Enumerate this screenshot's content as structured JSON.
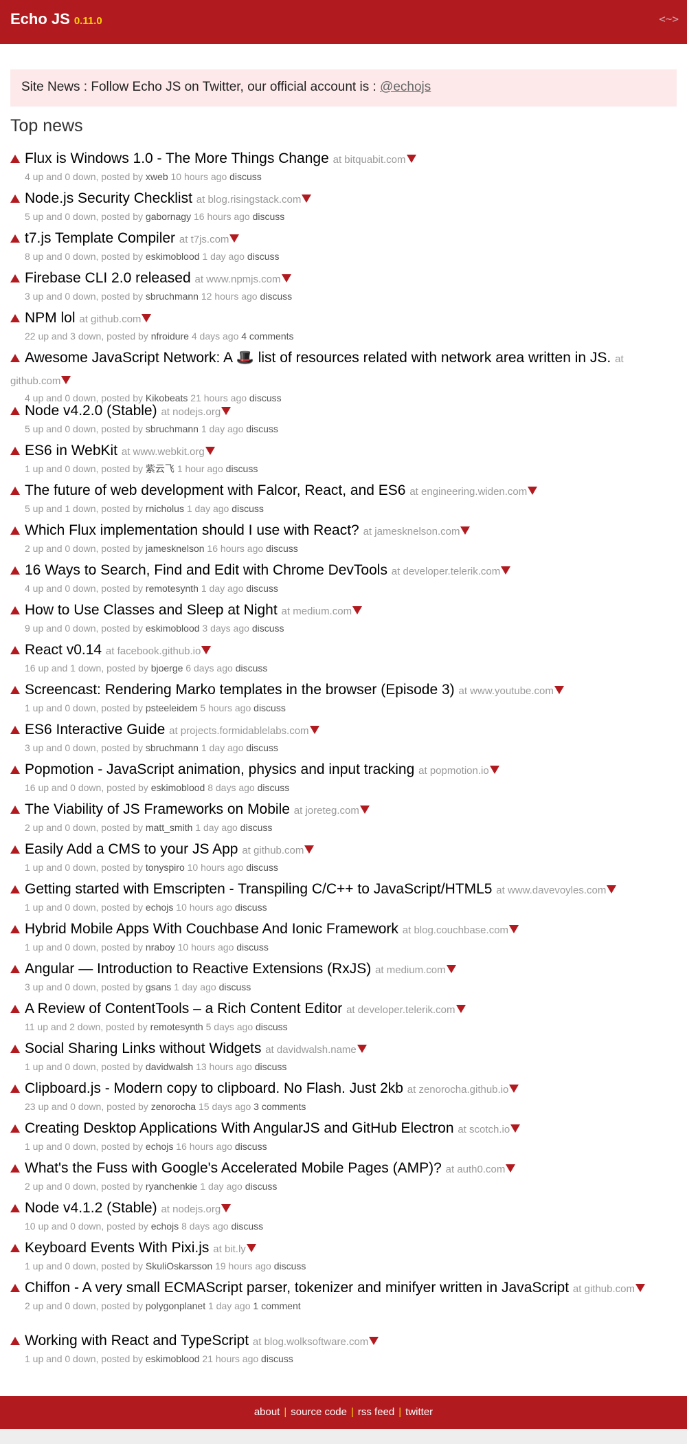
{
  "header": {
    "logo": "Echo JS",
    "version": "0.11.0",
    "nav_toggle": "<~>"
  },
  "site_news": {
    "text": "Site News : Follow Echo JS on Twitter, our official account is : ",
    "link": "@echojs"
  },
  "section_title": "Top news",
  "news": [
    {
      "title": "Flux is Windows 1.0 - The More Things Change",
      "domain": "at bitquabit.com",
      "votes": "4 up and 0 down, posted by",
      "user": "xweb",
      "ago": "10 hours ago",
      "discuss": "discuss"
    },
    {
      "title": "Node.js Security Checklist",
      "domain": "at blog.risingstack.com",
      "votes": "5 up and 0 down, posted by",
      "user": "gabornagy",
      "ago": "16 hours ago",
      "discuss": "discuss"
    },
    {
      "title": "t7.js Template Compiler",
      "domain": "at t7js.com",
      "votes": "8 up and 0 down, posted by",
      "user": "eskimoblood",
      "ago": "1 day ago",
      "discuss": "discuss"
    },
    {
      "title": "Firebase CLI 2.0 released",
      "domain": "at www.npmjs.com",
      "votes": "3 up and 0 down, posted by",
      "user": "sbruchmann",
      "ago": "12 hours ago",
      "discuss": "discuss"
    },
    {
      "title": "NPM lol",
      "domain": "at github.com",
      "votes": "22 up and 3 down, posted by",
      "user": "nfroidure",
      "ago": "4 days ago",
      "discuss": "4 comments"
    },
    {
      "title": "Awesome JavaScript Network: A 🎩 list of resources related with network area written in JS.",
      "domain": "at github.com",
      "votes": "4 up and 0 down, posted by",
      "user": "Kikobeats",
      "ago": "21 hours ago",
      "discuss": "discuss"
    },
    {
      "title": "Node v4.2.0 (Stable)",
      "domain": "at nodejs.org",
      "votes": "5 up and 0 down, posted by",
      "user": "sbruchmann",
      "ago": "1 day ago",
      "discuss": "discuss"
    },
    {
      "title": "ES6 in WebKit",
      "domain": "at www.webkit.org",
      "votes": "1 up and 0 down, posted by",
      "user": "紫云飞",
      "ago": "1 hour ago",
      "discuss": "discuss"
    },
    {
      "title": "The future of web development with Falcor, React, and ES6",
      "domain": "at engineering.widen.com",
      "votes": "5 up and 1 down, posted by",
      "user": "rnicholus",
      "ago": "1 day ago",
      "discuss": "discuss"
    },
    {
      "title": "Which Flux implementation should I use with React?",
      "domain": "at jamesknelson.com",
      "votes": "2 up and 0 down, posted by",
      "user": "jamesknelson",
      "ago": "16 hours ago",
      "discuss": "discuss"
    },
    {
      "title": "16 Ways to Search, Find and Edit with Chrome DevTools",
      "domain": "at developer.telerik.com",
      "votes": "4 up and 0 down, posted by",
      "user": "remotesynth",
      "ago": "1 day ago",
      "discuss": "discuss"
    },
    {
      "title": "How to Use Classes and Sleep at Night",
      "domain": "at medium.com",
      "votes": "9 up and 0 down, posted by",
      "user": "eskimoblood",
      "ago": "3 days ago",
      "discuss": "discuss"
    },
    {
      "title": "React v0.14",
      "domain": "at facebook.github.io",
      "votes": "16 up and 1 down, posted by",
      "user": "bjoerge",
      "ago": "6 days ago",
      "discuss": "discuss"
    },
    {
      "title": "Screencast: Rendering Marko templates in the browser (Episode 3)",
      "domain": "at www.youtube.com",
      "votes": "1 up and 0 down, posted by",
      "user": "psteeleidem",
      "ago": "5 hours ago",
      "discuss": "discuss"
    },
    {
      "title": "ES6 Interactive Guide",
      "domain": "at projects.formidablelabs.com",
      "votes": "3 up and 0 down, posted by",
      "user": "sbruchmann",
      "ago": "1 day ago",
      "discuss": "discuss"
    },
    {
      "title": "Popmotion - JavaScript animation, physics and input tracking",
      "domain": "at popmotion.io",
      "votes": "16 up and 0 down, posted by",
      "user": "eskimoblood",
      "ago": "8 days ago",
      "discuss": "discuss"
    },
    {
      "title": "The Viability of JS Frameworks on Mobile",
      "domain": "at joreteg.com",
      "votes": "2 up and 0 down, posted by",
      "user": "matt_smith",
      "ago": "1 day ago",
      "discuss": "discuss"
    },
    {
      "title": "Easily Add a CMS to your JS App",
      "domain": "at github.com",
      "votes": "1 up and 0 down, posted by",
      "user": "tonyspiro",
      "ago": "10 hours ago",
      "discuss": "discuss"
    },
    {
      "title": "Getting started with Emscripten - Transpiling C/C++ to JavaScript/HTML5",
      "domain": "at www.davevoyles.com",
      "votes": "1 up and 0 down, posted by",
      "user": "echojs",
      "ago": "10 hours ago",
      "discuss": "discuss"
    },
    {
      "title": "Hybrid Mobile Apps With Couchbase And Ionic Framework",
      "domain": "at blog.couchbase.com",
      "votes": "1 up and 0 down, posted by",
      "user": "nraboy",
      "ago": "10 hours ago",
      "discuss": "discuss"
    },
    {
      "title": "Angular — Introduction to Reactive Extensions (RxJS)",
      "domain": "at medium.com",
      "votes": "3 up and 0 down, posted by",
      "user": "gsans",
      "ago": "1 day ago",
      "discuss": "discuss"
    },
    {
      "title": "A Review of ContentTools – a Rich Content Editor",
      "domain": "at developer.telerik.com",
      "votes": "11 up and 2 down, posted by",
      "user": "remotesynth",
      "ago": "5 days ago",
      "discuss": "discuss"
    },
    {
      "title": "Social Sharing Links without Widgets",
      "domain": "at davidwalsh.name",
      "votes": "1 up and 0 down, posted by",
      "user": "davidwalsh",
      "ago": "13 hours ago",
      "discuss": "discuss"
    },
    {
      "title": "Clipboard.js - Modern copy to clipboard. No Flash. Just 2kb",
      "domain": "at zenorocha.github.io",
      "votes": "23 up and 0 down, posted by",
      "user": "zenorocha",
      "ago": "15 days ago",
      "discuss": "3 comments"
    },
    {
      "title": "Creating Desktop Applications With AngularJS and GitHub Electron",
      "domain": "at scotch.io",
      "votes": "1 up and 0 down, posted by",
      "user": "echojs",
      "ago": "16 hours ago",
      "discuss": "discuss"
    },
    {
      "title": "What's the Fuss with Google's Accelerated Mobile Pages (AMP)?",
      "domain": "at auth0.com",
      "votes": "2 up and 0 down, posted by",
      "user": "ryanchenkie",
      "ago": "1 day ago",
      "discuss": "discuss"
    },
    {
      "title": "Node v4.1.2 (Stable)",
      "domain": "at nodejs.org",
      "votes": "10 up and 0 down, posted by",
      "user": "echojs",
      "ago": "8 days ago",
      "discuss": "discuss"
    },
    {
      "title": "Keyboard Events With Pixi.js",
      "domain": "at bit.ly",
      "votes": "1 up and 0 down, posted by",
      "user": "SkuliOskarsson",
      "ago": "19 hours ago",
      "discuss": "discuss"
    },
    {
      "title": "Chiffon - A very small ECMAScript parser, tokenizer and minifyer written in JavaScript",
      "domain": "at github.com",
      "votes": "2 up and 0 down, posted by",
      "user": "polygonplanet",
      "ago": "1 day ago",
      "discuss": "1 comment"
    },
    {
      "title": "Working with React and TypeScript",
      "domain": "at blog.wolksoftware.com",
      "votes": "1 up and 0 down, posted by",
      "user": "eskimoblood",
      "ago": "21 hours ago",
      "discuss": "discuss"
    }
  ],
  "footer": {
    "links": [
      "about",
      "source code",
      "rss feed",
      "twitter"
    ],
    "separator": "|"
  }
}
